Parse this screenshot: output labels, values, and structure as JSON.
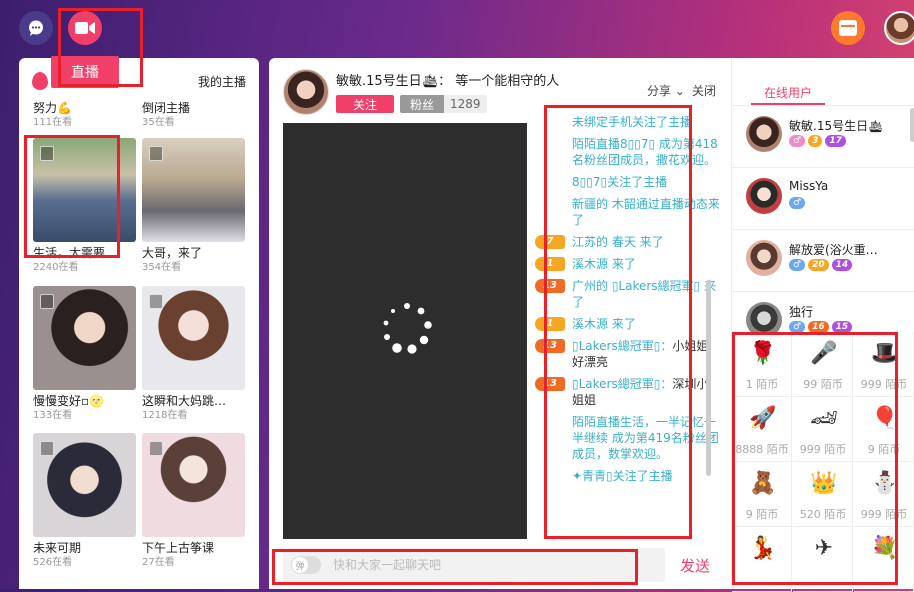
{
  "nav": {
    "live_label": "直播"
  },
  "left": {
    "mine_label": "我的主播",
    "top_items": [
      {
        "name": "努力💪",
        "count": "111在看"
      },
      {
        "name": "倒闭主播",
        "count": "35在看"
      }
    ],
    "cards": [
      {
        "name": "生活，太需要…",
        "count": "2240在看"
      },
      {
        "name": "大哥，来了",
        "count": "354在看"
      },
      {
        "name": "慢慢变好▫🌝",
        "count": "133在看"
      },
      {
        "name": "这瞬和大妈跳…",
        "count": "1218在看"
      },
      {
        "name": "未来可期",
        "count": "526在看"
      },
      {
        "name": "下午上古筝课",
        "count": "27在看"
      }
    ]
  },
  "main": {
    "host_name": "敏敏.15号生日🛳：  等一个能相守的人",
    "follow_label": "关注",
    "fans_label": "粉丝",
    "fans_count": "1289",
    "share_label": "分享",
    "close_label": "关闭",
    "input_placeholder": "快和大家一起聊天吧",
    "toggle_label": "弹",
    "send_label": "发送",
    "messages": [
      {
        "text": "未绑定手机关注了主播"
      },
      {
        "text": "陌陌直播8▯▯7▯ 成为第418名粉丝团成员，撒花欢迎。"
      },
      {
        "text": "8▯▯7▯关注了主播"
      },
      {
        "text": "新疆的 木韶通过直播动态来了"
      },
      {
        "level": "7",
        "text": "江苏的 春天 来了"
      },
      {
        "level": "1",
        "text": "溪木源 来了"
      },
      {
        "level": "13",
        "text": "广州的 ▯Lakers總冠軍▯ 来了"
      },
      {
        "level": "1",
        "text": "溪木源 来了"
      },
      {
        "level": "13",
        "text": "▯Lakers總冠軍▯：",
        "dark": "小姐姐好漂亮"
      },
      {
        "level": "13",
        "text": "▯Lakers總冠軍▯：",
        "dark": "深圳小姐姐"
      },
      {
        "text": "陌陌直播生活，一半记忆一半继续 成为第419名粉丝团成员，数掌欢迎。"
      },
      {
        "text": "✦青青▯关注了主播"
      }
    ]
  },
  "right": {
    "tab_label": "在线用户",
    "users": [
      {
        "name": "敏敏.15号生日🛳",
        "badges": [
          "♂",
          "3",
          "17"
        ]
      },
      {
        "name": "MissYa",
        "badges": [
          "♂"
        ]
      },
      {
        "name": "解放爱(浴火重…",
        "badges": [
          "♂",
          "20",
          "14"
        ]
      },
      {
        "name": "独行",
        "badges": [
          "♂",
          "16",
          "15"
        ]
      }
    ],
    "gifts": [
      {
        "icon": "rose",
        "glyph": "🌹",
        "price": "1 陌币"
      },
      {
        "icon": "microphone",
        "glyph": "🎤",
        "price": "99 陌币"
      },
      {
        "icon": "top-hat",
        "glyph": "🎩",
        "price": "999 陌币"
      },
      {
        "icon": "rocket",
        "glyph": "🚀",
        "price": "8888 陌币"
      },
      {
        "icon": "sports-car",
        "glyph": "🏎",
        "price": "999 陌币"
      },
      {
        "icon": "balloon",
        "glyph": "🎈",
        "price": "9 陌币"
      },
      {
        "icon": "gift-bear",
        "glyph": "🧸",
        "price": "9 陌币"
      },
      {
        "icon": "crown",
        "glyph": "👑",
        "price": "520 陌币"
      },
      {
        "icon": "snowman",
        "glyph": "⛄",
        "price": "999 陌币"
      },
      {
        "icon": "dancers",
        "glyph": "💃",
        "price": ""
      },
      {
        "icon": "airplane",
        "glyph": "✈",
        "price": ""
      },
      {
        "icon": "bouquet",
        "glyph": "💐",
        "price": ""
      }
    ]
  },
  "colors": {
    "accent": "#f0406a",
    "chat": "#3ab0c8",
    "highlight_box": "#e8202a"
  }
}
